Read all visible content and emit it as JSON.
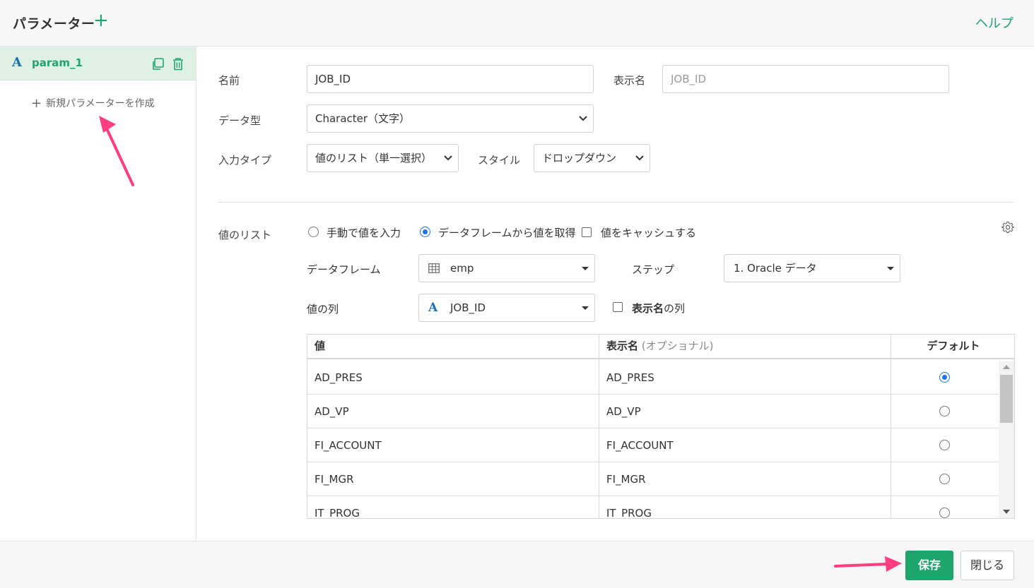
{
  "header": {
    "title": "パラメーター",
    "add_symbol": "+",
    "help_label": "ヘルプ"
  },
  "sidebar": {
    "param": {
      "type_glyph": "A",
      "name": "param_1"
    },
    "new_param_symbol": "+",
    "new_param_label": "新規パラメーターを作成"
  },
  "form": {
    "name_label": "名前",
    "name_value": "JOB_ID",
    "display_name_label": "表示名",
    "display_name_placeholder": "JOB_ID",
    "data_type_label": "データ型",
    "data_type_value": "Character（文字）",
    "input_type_label": "入力タイプ",
    "input_type_value": "値のリスト（単一選択）",
    "style_label": "スタイル",
    "style_value": "ドロップダウン"
  },
  "value_list": {
    "label": "値のリスト",
    "option_manual": "手動で値を入力",
    "option_dataframe": "データフレームから値を取得",
    "cache_label": "値をキャッシュする",
    "dataframe_label": "データフレーム",
    "dataframe_value": "emp",
    "step_label": "ステップ",
    "step_value": "1. Oracle データ",
    "value_column_label": "値の列",
    "value_column_type_glyph": "A",
    "value_column_value": "JOB_ID",
    "display_name_column_bold": "表示名",
    "display_name_column_rest": "の列"
  },
  "table": {
    "col_value": "値",
    "col_display": "表示名",
    "col_display_opt": " (オプショナル)",
    "col_default": "デフォルト",
    "rows": [
      {
        "value": "AD_PRES",
        "display": "AD_PRES",
        "default": true
      },
      {
        "value": "AD_VP",
        "display": "AD_VP",
        "default": false
      },
      {
        "value": "FI_ACCOUNT",
        "display": "FI_ACCOUNT",
        "default": false
      },
      {
        "value": "FI_MGR",
        "display": "FI_MGR",
        "default": false
      },
      {
        "value": "IT_PROG",
        "display": "IT_PROG",
        "default": false
      }
    ]
  },
  "footer": {
    "save_label": "保存",
    "close_label": "閉じる"
  },
  "colors": {
    "accent_green": "#1ea56e",
    "type_blue": "#1f6fb3",
    "annotation_pink": "#ff3d7f",
    "radio_blue": "#1a73e8"
  }
}
